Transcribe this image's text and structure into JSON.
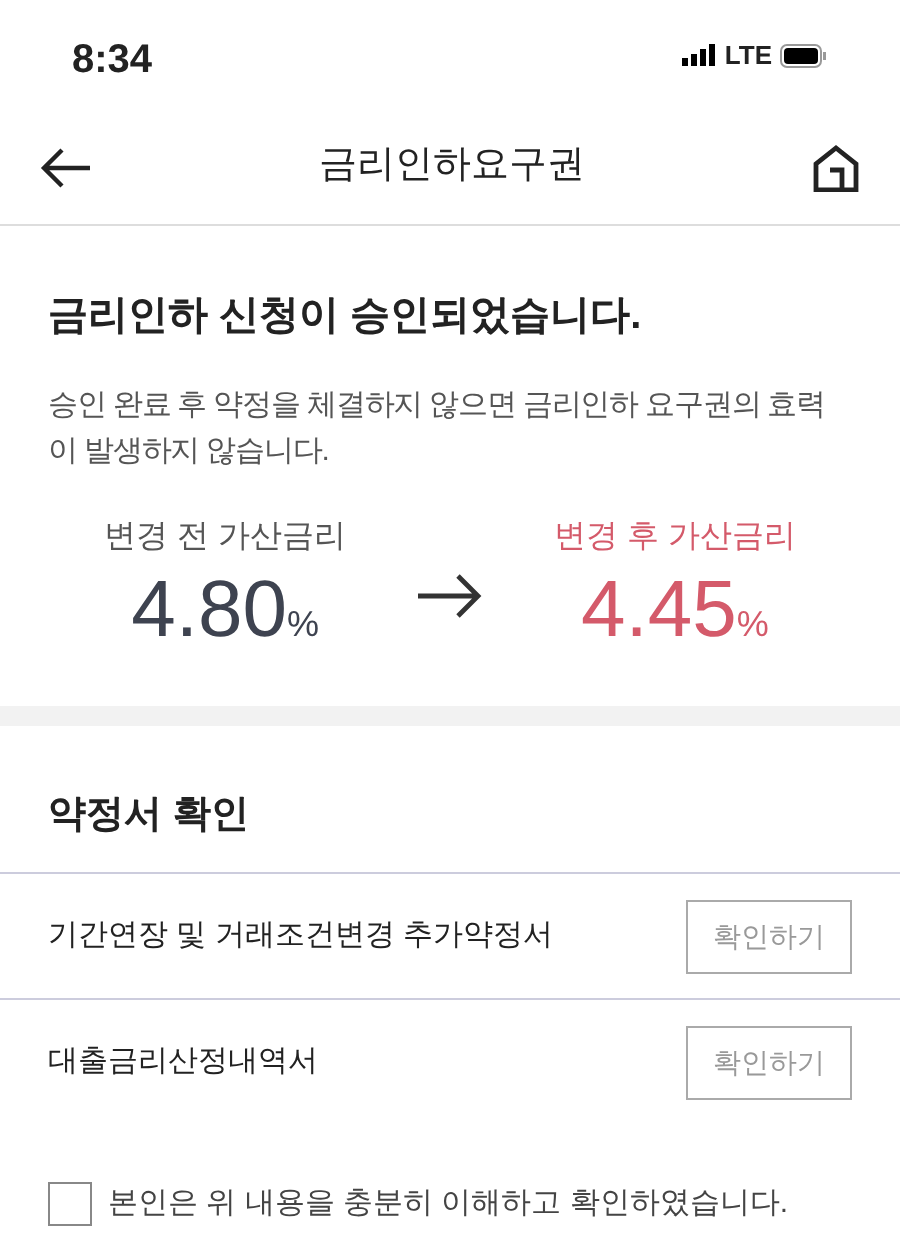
{
  "status_bar": {
    "time": "8:34",
    "network": "LTE"
  },
  "header": {
    "title": "금리인하요구권"
  },
  "result": {
    "title": "금리인하 신청이 승인되었습니다.",
    "description": "승인 완료 후 약정을 체결하지 않으면 금리인하 요구권의 효력이 발생하지 않습니다.",
    "before": {
      "label": "변경 전 가산금리",
      "value": "4.80",
      "unit": "%"
    },
    "after": {
      "label": "변경 후 가산금리",
      "value": "4.45",
      "unit": "%"
    }
  },
  "documents": {
    "title": "약정서 확인",
    "items": [
      {
        "name": "기간연장 및 거래조건변경 추가약정서",
        "button": "확인하기"
      },
      {
        "name": "대출금리산정내역서",
        "button": "확인하기"
      }
    ]
  },
  "agreement": {
    "label": "본인은 위 내용을 충분히 이해하고 확인하였습니다.",
    "checked": false
  }
}
